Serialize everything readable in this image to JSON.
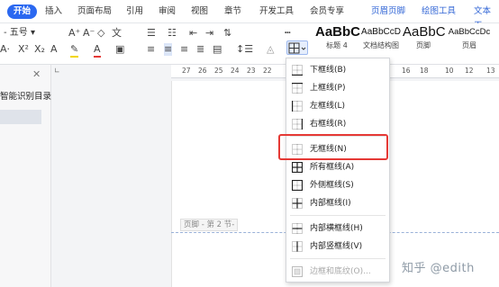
{
  "menubar": {
    "tabs": [
      "开始",
      "插入",
      "页面布局",
      "引用",
      "审阅",
      "视图",
      "章节",
      "开发工具",
      "会员专享",
      "页眉页脚",
      "绘图工具",
      "文本工"
    ]
  },
  "ribbon": {
    "font_size": "五号",
    "styles": [
      {
        "sample": "AaBbC",
        "caption": "标题 4"
      },
      {
        "sample": "AaBbCcD",
        "caption": "文档结构图"
      },
      {
        "sample": "AaBbC",
        "caption": "页脚"
      },
      {
        "sample": "AaBbCcDc",
        "caption": "页眉"
      }
    ]
  },
  "left_pane": {
    "title": "智能识别目录"
  },
  "ruler": {
    "numbers": [
      "27",
      "26",
      "25",
      "24",
      "23",
      "22",
      "16",
      "18",
      "10",
      "12",
      "13"
    ]
  },
  "document": {
    "footer_label": "页脚 - 第 2 节-"
  },
  "border_menu": {
    "items": [
      {
        "label": "下框线(B)",
        "icon": "border-bottom-icon"
      },
      {
        "label": "上框线(P)",
        "icon": "border-top-icon"
      },
      {
        "label": "左框线(L)",
        "icon": "border-left-icon"
      },
      {
        "label": "右框线(R)",
        "icon": "border-right-icon"
      },
      {
        "label": "无框线(N)",
        "icon": "border-none-icon"
      },
      {
        "label": "所有框线(A)",
        "icon": "border-all-icon"
      },
      {
        "label": "外侧框线(S)",
        "icon": "border-outside-icon"
      },
      {
        "label": "内部框线(I)",
        "icon": "border-inside-icon"
      },
      {
        "label": "内部横框线(H)",
        "icon": "border-inside-horizontal-icon"
      },
      {
        "label": "内部竖框线(V)",
        "icon": "border-inside-vertical-icon"
      },
      {
        "label": "边框和底纹(O)...",
        "icon": "borders-shading-icon",
        "disabled": true
      }
    ],
    "highlighted": "无框线(N)",
    "highlight_color": "#e53935"
  },
  "watermark": {
    "text": "知乎 @edith"
  },
  "colors": {
    "accent": "#2b68f0",
    "page_tab_blue": "#3367d6"
  }
}
